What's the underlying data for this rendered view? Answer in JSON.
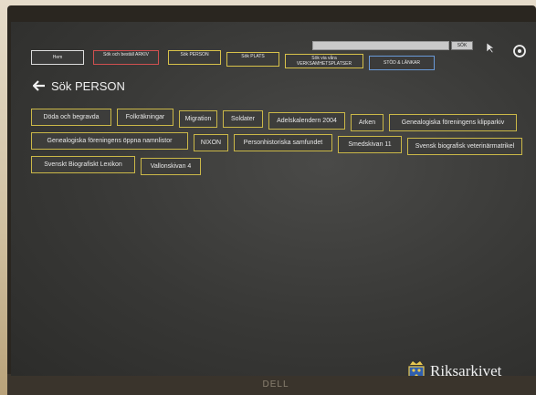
{
  "nav": {
    "hem": "Hem",
    "sok_arkiv": "Sök och beställ ARKIV",
    "sok_person": "Sök PERSON",
    "sok_plats": "Sök PLATS",
    "verksamhet": "Sök via våra VERKSAMHETSPLATSER",
    "stod": "STÖD & LÄNKAR"
  },
  "search": {
    "button_label": "SÖK"
  },
  "page": {
    "title": "Sök PERSON"
  },
  "person_buttons": [
    "Döda och begravda",
    "Folkräkningar",
    "Migration",
    "Soldater",
    "Adelskalendern 2004",
    "Arken",
    "Genealogiska föreningens klipparkiv",
    "Genealogiska föreningens öppna namnlistor",
    "NIXON",
    "Personhistoriska samfundet",
    "Smedskivan 11",
    "Svensk biografisk veterinärmatrikel",
    "Svenskt Biografiskt Lexikon",
    "Vallonskivan 4"
  ],
  "brand": {
    "name": "Riksarkivet"
  },
  "monitor": {
    "label": "DELL"
  }
}
